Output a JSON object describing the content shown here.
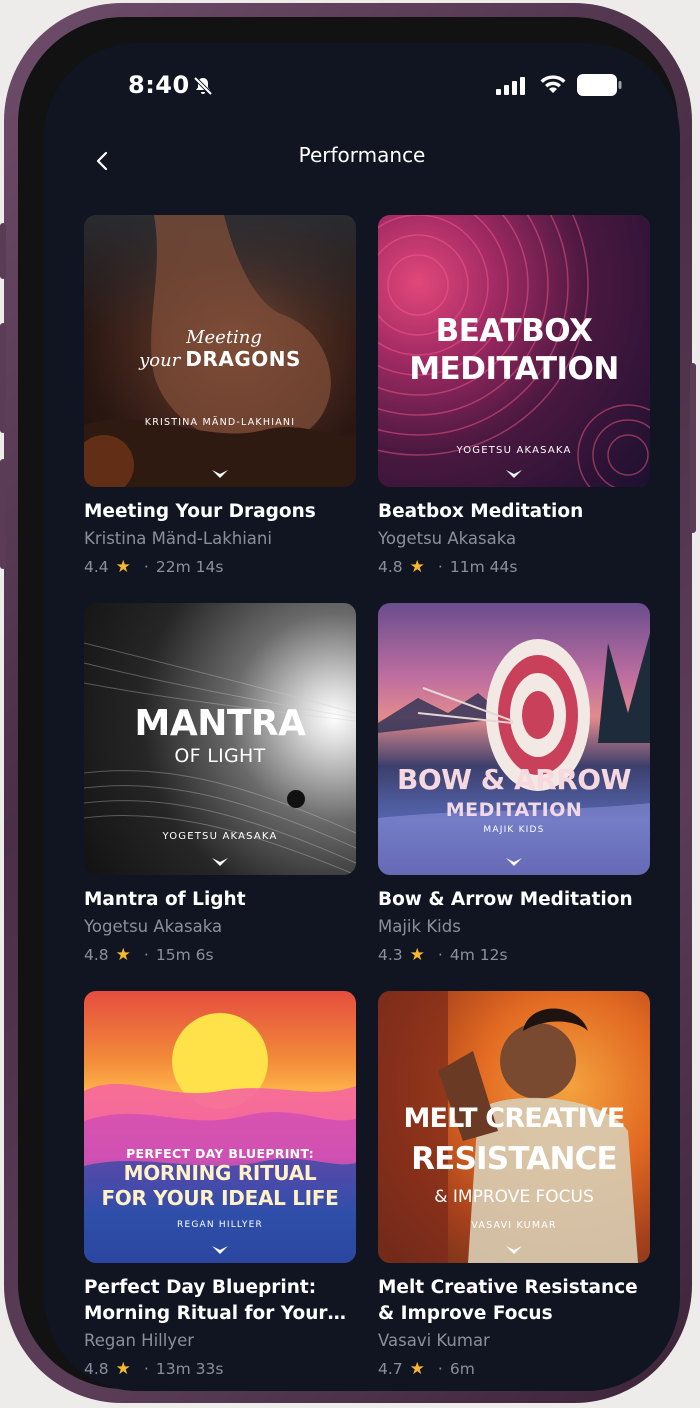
{
  "status_bar": {
    "time": "8:40",
    "icons": [
      "bell-slash-icon",
      "signal-icon",
      "wifi-icon",
      "battery-icon"
    ]
  },
  "header": {
    "title": "Performance",
    "back_icon": "chevron-left-icon"
  },
  "colors": {
    "background": "#111522",
    "text_primary": "#ffffff",
    "text_secondary": "#8b8f9b",
    "star": "#f5b82e"
  },
  "items": [
    {
      "title": "Meeting Your Dragons",
      "author": "Kristina Mänd-Lakhiani",
      "rating": "4.4",
      "duration": "22m 14s",
      "cover": {
        "line1": "Meeting",
        "line2a": "your",
        "line2b": "DRAGONS",
        "author": "KRISTINA MÄND-LAKHIANI"
      }
    },
    {
      "title": "Beatbox Meditation",
      "author": "Yogetsu Akasaka",
      "rating": "4.8",
      "duration": "11m 44s",
      "cover": {
        "line1": "BEATBOX",
        "line2": "MEDITATION",
        "author": "YOGETSU AKASAKA"
      }
    },
    {
      "title": "Mantra of Light",
      "author": "Yogetsu Akasaka",
      "rating": "4.8",
      "duration": "15m 6s",
      "cover": {
        "line1": "MANTRA",
        "line2": "OF LIGHT",
        "author": "YOGETSU AKASAKA"
      }
    },
    {
      "title": "Bow & Arrow Meditation",
      "author": "Majik Kids",
      "rating": "4.3",
      "duration": "4m 12s",
      "cover": {
        "line1": "BOW & ARROW",
        "line2": "MEDITATION",
        "author": "MAJIK KIDS"
      }
    },
    {
      "title": "Perfect Day Blueprint: Morning Ritual for Your…",
      "author": "Regan Hillyer",
      "rating": "4.8",
      "duration": "13m 33s",
      "cover": {
        "line1": "PERFECT DAY BLUEPRINT:",
        "line2": "MORNING RITUAL",
        "line3": "FOR YOUR IDEAL LIFE",
        "author": "REGAN HILLYER"
      }
    },
    {
      "title": "Melt Creative Resistance & Improve Focus",
      "author": "Vasavi Kumar",
      "rating": "4.7",
      "duration": "6m",
      "cover": {
        "line1": "MELT CREATIVE",
        "line2": "RESISTANCE",
        "line3": "& IMPROVE FOCUS",
        "author": "VASAVI KUMAR"
      }
    }
  ]
}
